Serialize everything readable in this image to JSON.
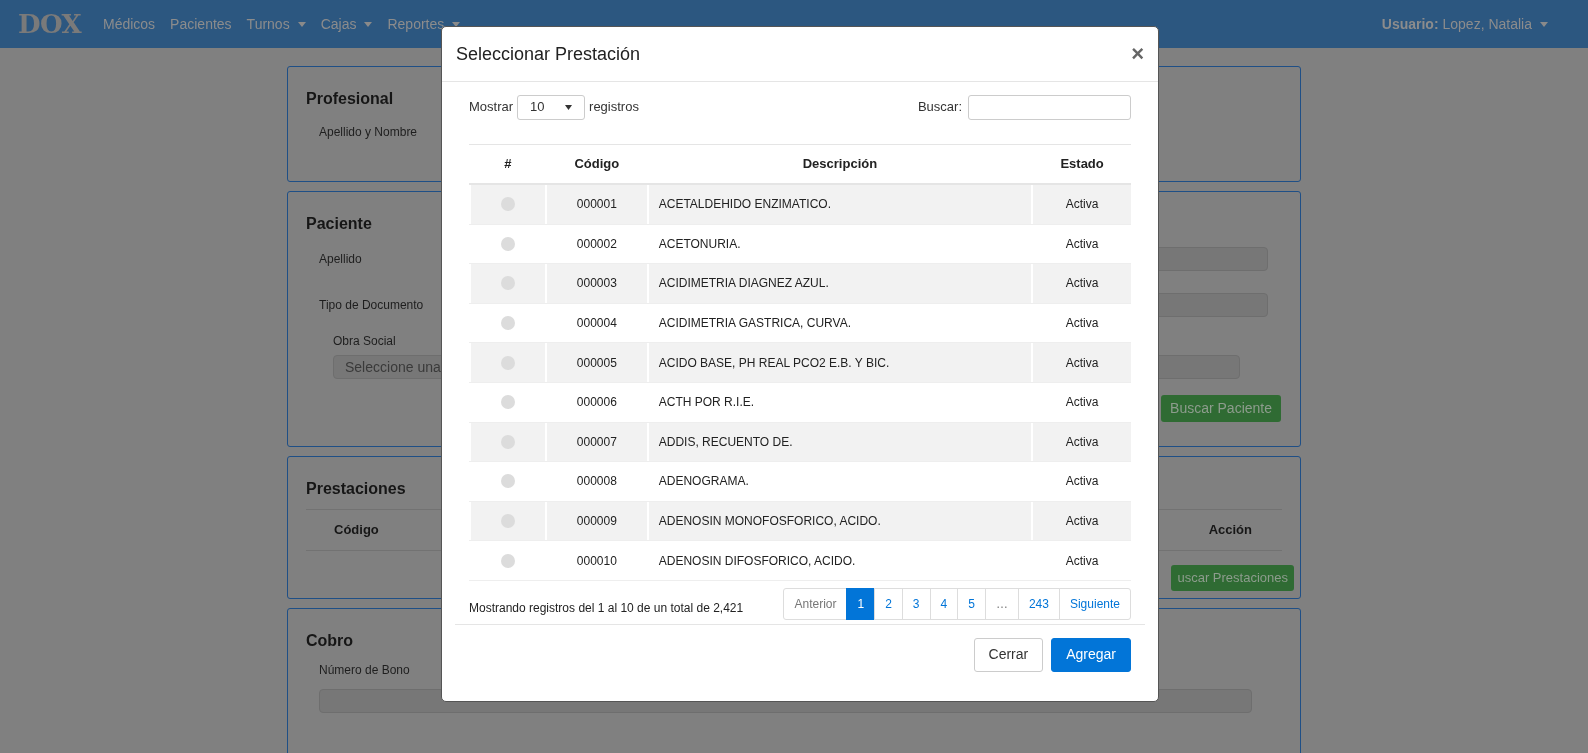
{
  "navbar": {
    "logo": "DOX",
    "menu": [
      {
        "label": "Médicos",
        "dropdown": false
      },
      {
        "label": "Pacientes",
        "dropdown": false
      },
      {
        "label": "Turnos",
        "dropdown": true
      },
      {
        "label": "Cajas",
        "dropdown": true
      },
      {
        "label": "Reportes",
        "dropdown": true
      }
    ],
    "user": "**Usuario:** Lopez, Natalia"
  },
  "background": {
    "profesional": {
      "title": "Profesional",
      "label": "Apellido y Nombre"
    },
    "paciente": {
      "title": "Paciente",
      "labels": [
        "Apellido",
        "Tipo de Documento"
      ],
      "obra_social_label": "Obra Social",
      "obra_social_value": "Seleccione una",
      "button": "Buscar Paciente"
    },
    "prestaciones": {
      "title": "Prestaciones",
      "columns": [
        "Código",
        "Acción"
      ],
      "button": "uscar Prestaciones"
    },
    "cobro": {
      "title": "Cobro",
      "label": "Número de Bono"
    }
  },
  "modal": {
    "title": "Seleccionar Prestación",
    "close": "×",
    "show_label": "Mostrar",
    "show_value": "10",
    "show_suffix": "registros",
    "search_label": "Buscar:",
    "columns": [
      "#",
      "Código",
      "Descripción",
      "Estado"
    ],
    "rows": [
      {
        "code": "000001",
        "description": "ACETALDEHIDO ENZIMATICO.",
        "status": "Activa",
        "selected": false
      },
      {
        "code": "000002",
        "description": "ACETONURIA.",
        "status": "Activa",
        "selected": false
      },
      {
        "code": "000003",
        "description": "ACIDIMETRIA DIAGNEZ AZUL.",
        "status": "Activa",
        "selected": false
      },
      {
        "code": "000004",
        "description": "ACIDIMETRIA GASTRICA, CURVA.",
        "status": "Activa",
        "selected": false
      },
      {
        "code": "000005",
        "description": "ACIDO BASE, PH REAL PCO2 E.B. Y BIC.",
        "status": "Activa",
        "selected": false
      },
      {
        "code": "000006",
        "description": "ACTH POR R.I.E.",
        "status": "Activa",
        "selected": false
      },
      {
        "code": "000007",
        "description": "ADDIS, RECUENTO DE.",
        "status": "Activa",
        "selected": false
      },
      {
        "code": "000008",
        "description": "ADENOGRAMA.",
        "status": "Activa",
        "selected": false
      },
      {
        "code": "000009",
        "description": "ADENOSIN MONOFOSFORICO, ACIDO.",
        "status": "Activa",
        "selected": false
      },
      {
        "code": "000010",
        "description": "ADENOSIN DIFOSFORICO, ACIDO.",
        "status": "Activa",
        "selected": false
      }
    ],
    "info": "Mostrando registros del 1 al 10 de un total de 2,421",
    "pagination": [
      {
        "label": "Anterior",
        "selected": false,
        "disabled": true
      },
      {
        "label": "1",
        "selected": true,
        "disabled": false
      },
      {
        "label": "2",
        "selected": false,
        "disabled": false
      },
      {
        "label": "3",
        "selected": false,
        "disabled": false
      },
      {
        "label": "4",
        "selected": false,
        "disabled": false
      },
      {
        "label": "5",
        "selected": false,
        "disabled": false
      },
      {
        "label": "…",
        "selected": false,
        "disabled": true
      },
      {
        "label": "243",
        "selected": false,
        "disabled": false
      },
      {
        "label": "Siguiente",
        "selected": false,
        "disabled": false
      }
    ],
    "buttons": [
      {
        "label": "Cerrar",
        "kind": "secondary"
      },
      {
        "label": "Agregar",
        "kind": "primary"
      }
    ]
  }
}
